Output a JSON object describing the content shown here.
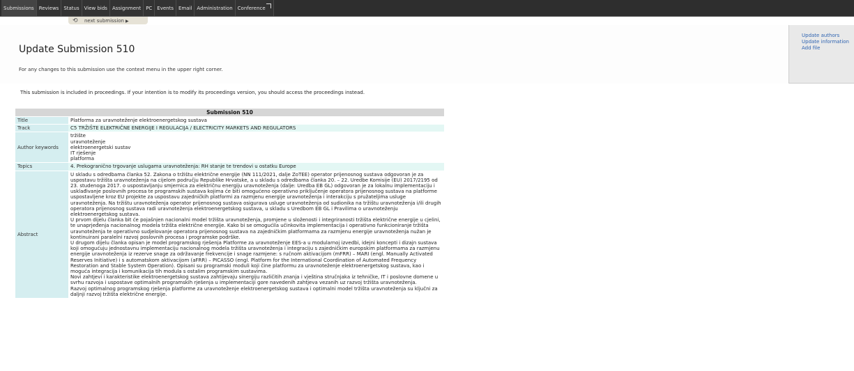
{
  "nav": {
    "items": [
      "Submissions",
      "Reviews",
      "Status",
      "View bids",
      "Assignment",
      "PC",
      "Events",
      "Email",
      "Administration",
      "Conference"
    ]
  },
  "subbar": {
    "next_label": "next submission"
  },
  "header": {
    "title": "Update Submission 510",
    "note": "For any changes to this submission use the context menu in the upper right corner."
  },
  "context_menu": {
    "items": [
      "Update authors",
      "Update information",
      "Add file"
    ]
  },
  "proceedings_note": "This submission is included in proceedings. If your intention is to modify its proceedings version, you should access the proceedings instead.",
  "table": {
    "heading": "Submission 510",
    "title_label": "Title",
    "title_value": "Platforma za uravnoteženje elektroenergetskog sustava",
    "track_label": "Track",
    "track_value": "C5 TRŽIŠTE ELEKTRIČNE ENERGIJE I REGULACIJA / ELECTRICITY MARKETS AND REGULATORS",
    "keywords_label": "Author keywords",
    "keywords": [
      "tržište",
      "uravnoteženje",
      "elektroenergetski sustav",
      "IT rješenje",
      "platforma"
    ],
    "topics_label": "Topics",
    "topics_value": "4. Prekogranično trgovanje uslugama uravnoteženja: RH stanje te trendovi u ostatku Europe",
    "abstract_label": "Abstract",
    "abstract": [
      "U skladu s odredbama članka 52. Zakona o tržištu električne energije (NN 111/2021, dalje ZoTEE) operator prijenosnog sustava odgovoran je za uspostavu tržišta uravnoteženja na cijelom području Republike Hrvatske, a u skladu s odredbama članka 20. – 22. Uredbe Komisije (EU) 2017/2195 od 23. studenoga 2017. o uspostavljanju smjernica za električnu energiju uravnoteženja (dalje: Uredba EB GL) odgovoran je za lokalnu implementaciju i usklađivanje poslovnih procesa te programskih sustava kojima će biti omogućeno operativno priključenje operatora prijenosnog sustava na platforme uspostavljene kroz EU projekte za uspostavu zajedničkih platformi za razmjenu energije uravnoteženja i interakciju s pružateljima usluge uravnoteženja. Na tržištu uravnoteženja operator prijenosnog sustava osigurava usluge uravnoteženja od sudionika na tržištu uravnoteženja i/ili drugih operatora prijenosnog sustava radi uravnoteženja elektroenergetskog sustava, u skladu s Uredbom EB GL i Pravilima o uravnoteženju elektroenergetskog sustava.",
      "U prvom dijelu članka bit će pojašnjen nacionalni model tržišta uravnoteženja, promjene u složenosti i integriranosti tržišta električne energije u cjelini, te unaprjeđenja nacionalnog modela tržišta električne energije. Kako bi se omogućila učinkovita implementacija i operativno funkcioniranje tržišta uravnoteženja te operativno sudjelovanje operatora prijenosnog sustava na zajedničkim platformama za razmjenu energije uravnoteženja nužan je kontinuirani paralelni razvoj poslovnih procesa i programske podrške.",
      "U drugom dijelu članka opisan je model programskog rješenja Platforme za uravnoteženje EES-a u modularnoj izvedbi, idejni koncepti i dizajn sustava koji omogućuju jednostavnu implementaciju nacionalnog modela tržišta uravnoteženja i integraciju s zajedničkim europskim platformama za razmjenu energije uravnoteženja iz rezerve snage za održavanje frekvencije i snage razmjene: s ručnom aktivacijom (mFRR) – MARI (engl. Manually Activated Reserves Initiative) i s automatskom aktivacijom (aFRR) – PICASSO (engl. Platform for the International Coordination of Automated Frequency Restoration and Stable System Operation). Opisani su programski moduli koji čine platformu za uravnoteženje elektroenergetskog sustava, kao i moguća integracija i komunikacija tih modula s ostalim programskim sustavima.",
      "Novi zahtjevi i karakteristike elektroenergetskog sustava zahtijevaju sinergiju različitih znanja i vještina stručnjaka iz tehničke, IT i poslovne domene u svrhu razvoja i uspostave optimalnih programskih rješenja u implementaciji gore navedenih zahtjeva vezanih uz razvoj tržišta uravnoteženja.",
      "Razvoj optimalnog programskog rješenja platforme za uravnoteženje elektroenergetskog sustava i optimalni model tržišta uravnoteženja su ključni za daljnji razvoj tržišta električne energije."
    ]
  }
}
